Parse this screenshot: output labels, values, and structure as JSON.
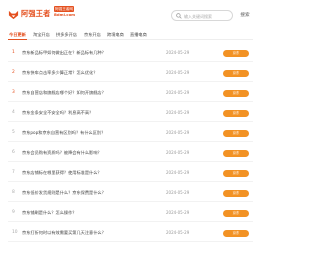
{
  "header": {
    "logo_text": "阿强王者",
    "badge_top": "阿强王者网",
    "badge_bottom": "Bdmi.com"
  },
  "search": {
    "placeholder": "输入关键词搜索",
    "button_label": "搜索"
  },
  "nav": {
    "items": [
      {
        "label": "今日更新"
      },
      {
        "label": "淘宝开店"
      },
      {
        "label": "拼多多开店"
      },
      {
        "label": "京东开店"
      },
      {
        "label": "跨境电商"
      },
      {
        "label": "直播电商"
      }
    ]
  },
  "articles": [
    {
      "num": "1",
      "title": "京东新品标甲如何做出正在？新品标有几种？",
      "date": "2024-05-29",
      "tag": "京东"
    },
    {
      "num": "2",
      "title": "京东快车点击率多少算正常？怎么优化？",
      "date": "2024-05-29",
      "tag": "京东"
    },
    {
      "num": "3",
      "title": "京东自营店和旗舰店哪个好？如何开旗舰店？",
      "date": "2024-05-29",
      "tag": "京东"
    },
    {
      "num": "4",
      "title": "京东金条安全不安全吗？利息高不高？",
      "date": "2024-05-29",
      "tag": "京东"
    },
    {
      "num": "5",
      "title": "京东pop和京东自营有区别吗？有什么区别？",
      "date": "2024-05-29",
      "tag": "京东"
    },
    {
      "num": "6",
      "title": "京东会员购有资质吗？被降会有什么影响？",
      "date": "2024-05-29",
      "tag": "京东"
    },
    {
      "num": "7",
      "title": "京东店铺标在哪里获得？使用标准是什么？",
      "date": "2024-05-29",
      "tag": "京东"
    },
    {
      "num": "8",
      "title": "京东低价发货规则是什么？京东保费是什么？",
      "date": "2024-05-29",
      "tag": "京东"
    },
    {
      "num": "9",
      "title": "京东铺刷是什么？怎么操作？",
      "date": "2024-05-29",
      "tag": "京东"
    },
    {
      "num": "10",
      "title": "京东打折何时以有效需要买第几天注意什么？",
      "date": "2024-05-29",
      "tag": "京东"
    }
  ],
  "colors": {
    "accent": "#e4501f",
    "tag": "#f29224"
  }
}
